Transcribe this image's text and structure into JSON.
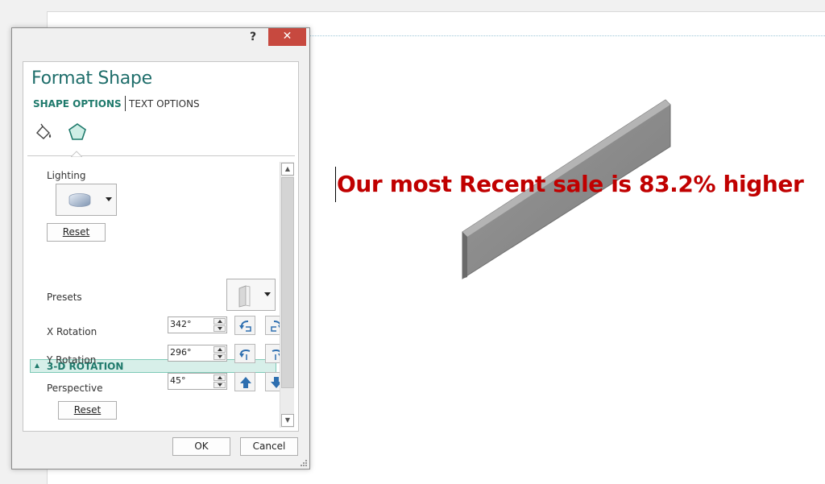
{
  "slide": {
    "text": "Our most Recent sale is 83.2% higher"
  },
  "dialog": {
    "help_label": "?",
    "close_label": "✕",
    "title": "Format Shape",
    "tabs": {
      "shape_options": "SHAPE OPTIONS",
      "text_options": "TEXT OPTIONS"
    },
    "icons": {
      "fill": "fill-line-icon",
      "effects": "effects-pentagon-icon"
    },
    "lighting": {
      "label": "Lighting",
      "reset_label": "Reset"
    },
    "rotation": {
      "section_title": "3-D ROTATION",
      "presets_label": "Presets",
      "x_label": "X Rotation",
      "x_value": "342°",
      "y_label": "Y Rotation",
      "y_value": "296°",
      "perspective_label": "Perspective",
      "perspective_value": "45°",
      "reset_label": "Reset"
    },
    "ok_label": "OK",
    "cancel_label": "Cancel"
  },
  "colors": {
    "accent": "#1f7a6c",
    "slide_text": "#c00000",
    "close_button": "#c7493f"
  }
}
